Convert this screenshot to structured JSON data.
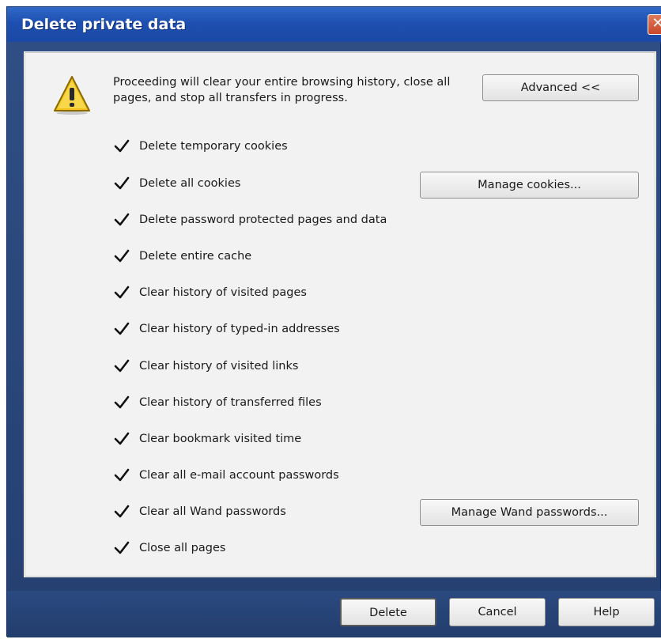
{
  "window": {
    "title": "Delete private data",
    "close_glyph": "✕"
  },
  "intro": {
    "icon": "warning-icon",
    "text": "Proceeding will clear your entire browsing history, close all pages, and stop all transfers in progress."
  },
  "buttons": {
    "advanced": "Advanced <<",
    "manage_cookies": "Manage cookies...",
    "manage_wand": "Manage Wand passwords...",
    "delete": "Delete",
    "cancel": "Cancel",
    "help": "Help"
  },
  "options": [
    {
      "label": "Delete temporary cookies",
      "checked": true
    },
    {
      "label": "Delete all cookies",
      "checked": true
    },
    {
      "label": "Delete password protected pages and data",
      "checked": true
    },
    {
      "label": "Delete entire cache",
      "checked": true
    },
    {
      "label": "Clear history of visited pages",
      "checked": true
    },
    {
      "label": "Clear history of typed-in addresses",
      "checked": true
    },
    {
      "label": "Clear history of visited links",
      "checked": true
    },
    {
      "label": "Clear history of transferred files",
      "checked": true
    },
    {
      "label": "Clear bookmark visited time",
      "checked": true
    },
    {
      "label": "Clear all e-mail account passwords",
      "checked": true
    },
    {
      "label": "Clear all Wand passwords",
      "checked": true
    },
    {
      "label": "Close all pages",
      "checked": true
    }
  ],
  "colors": {
    "titlebar": "#1e4fb0",
    "panel": "#f2f2f2",
    "frame": "#2b4a80"
  }
}
